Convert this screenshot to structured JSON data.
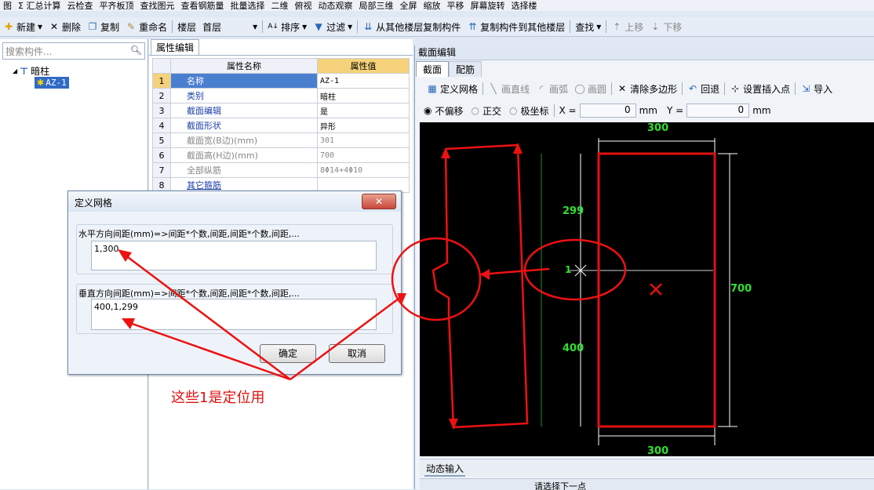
{
  "top_toolbar": {
    "items": [
      "图",
      "Σ 汇总计算",
      "云检查",
      "平齐板顶",
      "查找图元",
      "查看钢筋量",
      "批量选择",
      "二维",
      "俯视",
      "动态观察",
      "局部三维",
      "全屏",
      "缩放",
      "平移",
      "屏幕旋转",
      "选择楼"
    ]
  },
  "main_toolbar": {
    "new": "新建",
    "delete": "删除",
    "copy": "复制",
    "rename": "重命名",
    "floor_label": "楼层",
    "floor_value": "首层",
    "sort": "排序",
    "filter": "过滤",
    "copy_from": "从其他楼层复制构件",
    "copy_to": "复制构件到其他楼层",
    "find": "查找",
    "move_up": "上移",
    "move_down": "下移"
  },
  "left_panel": {
    "search_placeholder": "搜索构件...",
    "tree_root": "暗柱",
    "tree_child": "AZ-1"
  },
  "property_panel": {
    "tab": "属性编辑",
    "header_name": "属性名称",
    "header_value": "属性值",
    "rows": [
      {
        "num": "1",
        "name": "名称",
        "value": "AZ-1"
      },
      {
        "num": "2",
        "name": "类别",
        "value": "暗柱"
      },
      {
        "num": "3",
        "name": "截面编辑",
        "value": "是"
      },
      {
        "num": "4",
        "name": "截面形状",
        "value": "异形"
      },
      {
        "num": "5",
        "name": "截面宽(B边)(mm)",
        "value": "301"
      },
      {
        "num": "6",
        "name": "截面高(H边)(mm)",
        "value": "700"
      },
      {
        "num": "7",
        "name": "全部纵筋",
        "value": "8Φ14+4Φ10"
      },
      {
        "num": "8",
        "name": "其它箍筋",
        "value": ""
      }
    ]
  },
  "section_editor": {
    "title": "截面编辑",
    "tabs": [
      "截面",
      "配筋"
    ],
    "tools": [
      "定义网格",
      "画直线",
      "画弧",
      "画圆",
      "清除多边形",
      "回退",
      "设置插入点",
      "导入"
    ],
    "radio_no_offset": "不偏移",
    "radio_ortho": "正交",
    "radio_polar": "极坐标",
    "x_label": "X =",
    "x_value": "0",
    "y_label": "Y =",
    "y_value": "0",
    "unit": "mm",
    "dim_top": "300",
    "dim_bottom": "300",
    "dim_right": "700",
    "dim_299": "299",
    "dim_1": "1",
    "dim_400": "400",
    "dyn_input": "动态输入",
    "status_text": "请选择下一点"
  },
  "dialog": {
    "title": "定义网格",
    "h_label": "水平方向间距(mm)=>间距*个数,间距,间距*个数,间距,...",
    "h_value": "1,300",
    "v_label": "垂直方向间距(mm)=>间距*个数,间距,间距*个数,间距,...",
    "v_value": "400,1,299",
    "ok": "确定",
    "cancel": "取消"
  },
  "annotation": {
    "text": "这些1是定位用"
  }
}
